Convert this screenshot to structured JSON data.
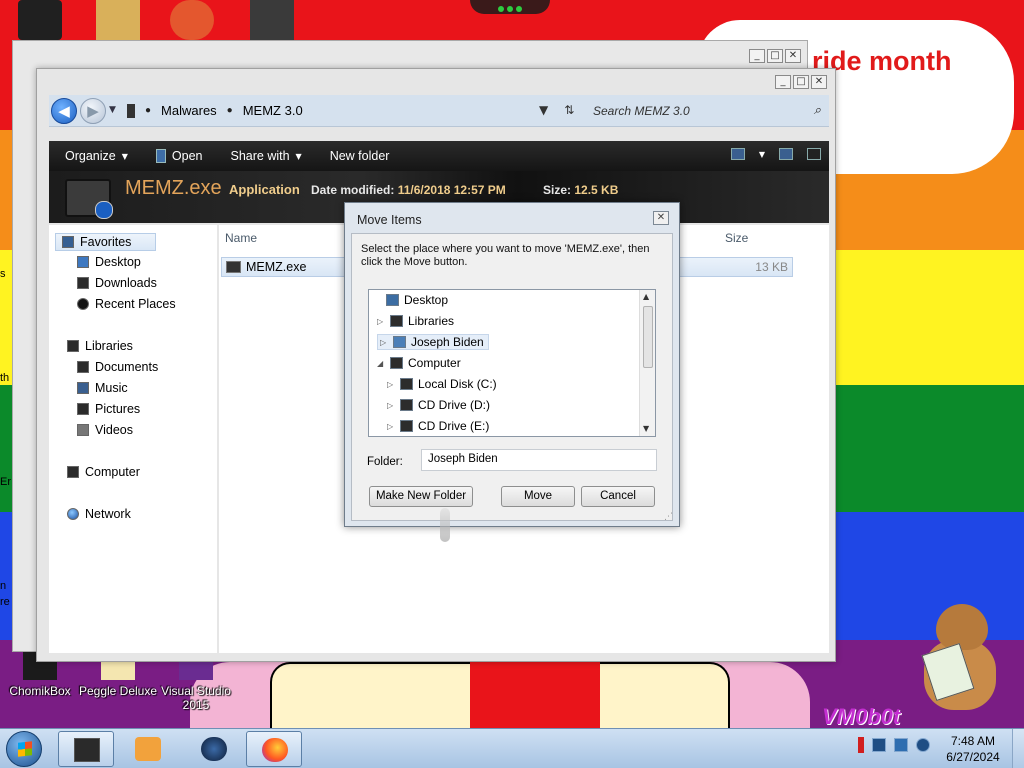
{
  "desktop": {
    "balloon_text": "ride month",
    "edge_labels": [
      "s",
      "th",
      "Er",
      "n",
      "re"
    ],
    "icons": [
      {
        "label": "ChomikBox"
      },
      {
        "label": "Peggle Deluxe"
      },
      {
        "label": "Visual Studio 2015"
      }
    ],
    "watermark": "VM0b0t"
  },
  "window": {
    "caption_buttons": [
      "_",
      "□",
      "✕"
    ],
    "breadcrumb": [
      "Malwares",
      "MEMZ 3.0"
    ],
    "search_placeholder": "Search MEMZ 3.0",
    "toolbar": {
      "organize": "Organize",
      "open": "Open",
      "share_with": "Share with",
      "new_folder": "New folder"
    },
    "details": {
      "file_name": "MEMZ.exe",
      "file_type": "Application",
      "date_label": "Date modified:",
      "date_value": "11/6/2018 12:57 PM",
      "size_label": "Size:",
      "size_value": "12.5 KB"
    },
    "nav": {
      "favorites": "Favorites",
      "desktop": "Desktop",
      "downloads": "Downloads",
      "recent_places": "Recent Places",
      "libraries": "Libraries",
      "documents": "Documents",
      "music": "Music",
      "pictures": "Pictures",
      "videos": "Videos",
      "computer": "Computer",
      "network": "Network"
    },
    "columns": {
      "name": "Name",
      "size": "Size"
    },
    "files": [
      {
        "name": "MEMZ.exe",
        "size": "13 KB"
      }
    ]
  },
  "dialog": {
    "title": "Move Items",
    "instruction": "Select the place where you want to move 'MEMZ.exe', then click the Move button.",
    "tree": [
      {
        "label": "Desktop",
        "level": 0
      },
      {
        "label": "Libraries",
        "level": 1
      },
      {
        "label": "Joseph Biden",
        "level": 1,
        "selected": true
      },
      {
        "label": "Computer",
        "level": 1,
        "expanded": true
      },
      {
        "label": "Local Disk (C:)",
        "level": 2
      },
      {
        "label": "CD Drive (D:)",
        "level": 2
      },
      {
        "label": "CD Drive (E:)",
        "level": 2
      }
    ],
    "folder_label": "Folder:",
    "folder_value": "Joseph Biden",
    "make_new_folder": "Make New Folder",
    "move": "Move",
    "cancel": "Cancel"
  },
  "taskbar": {
    "time": "7:48 AM",
    "date": "6/27/2024"
  },
  "colors": {
    "details_accent": "#e3a45a",
    "balloon_text": "#e11a1a",
    "taskbar_top": "#cfe0f3"
  }
}
